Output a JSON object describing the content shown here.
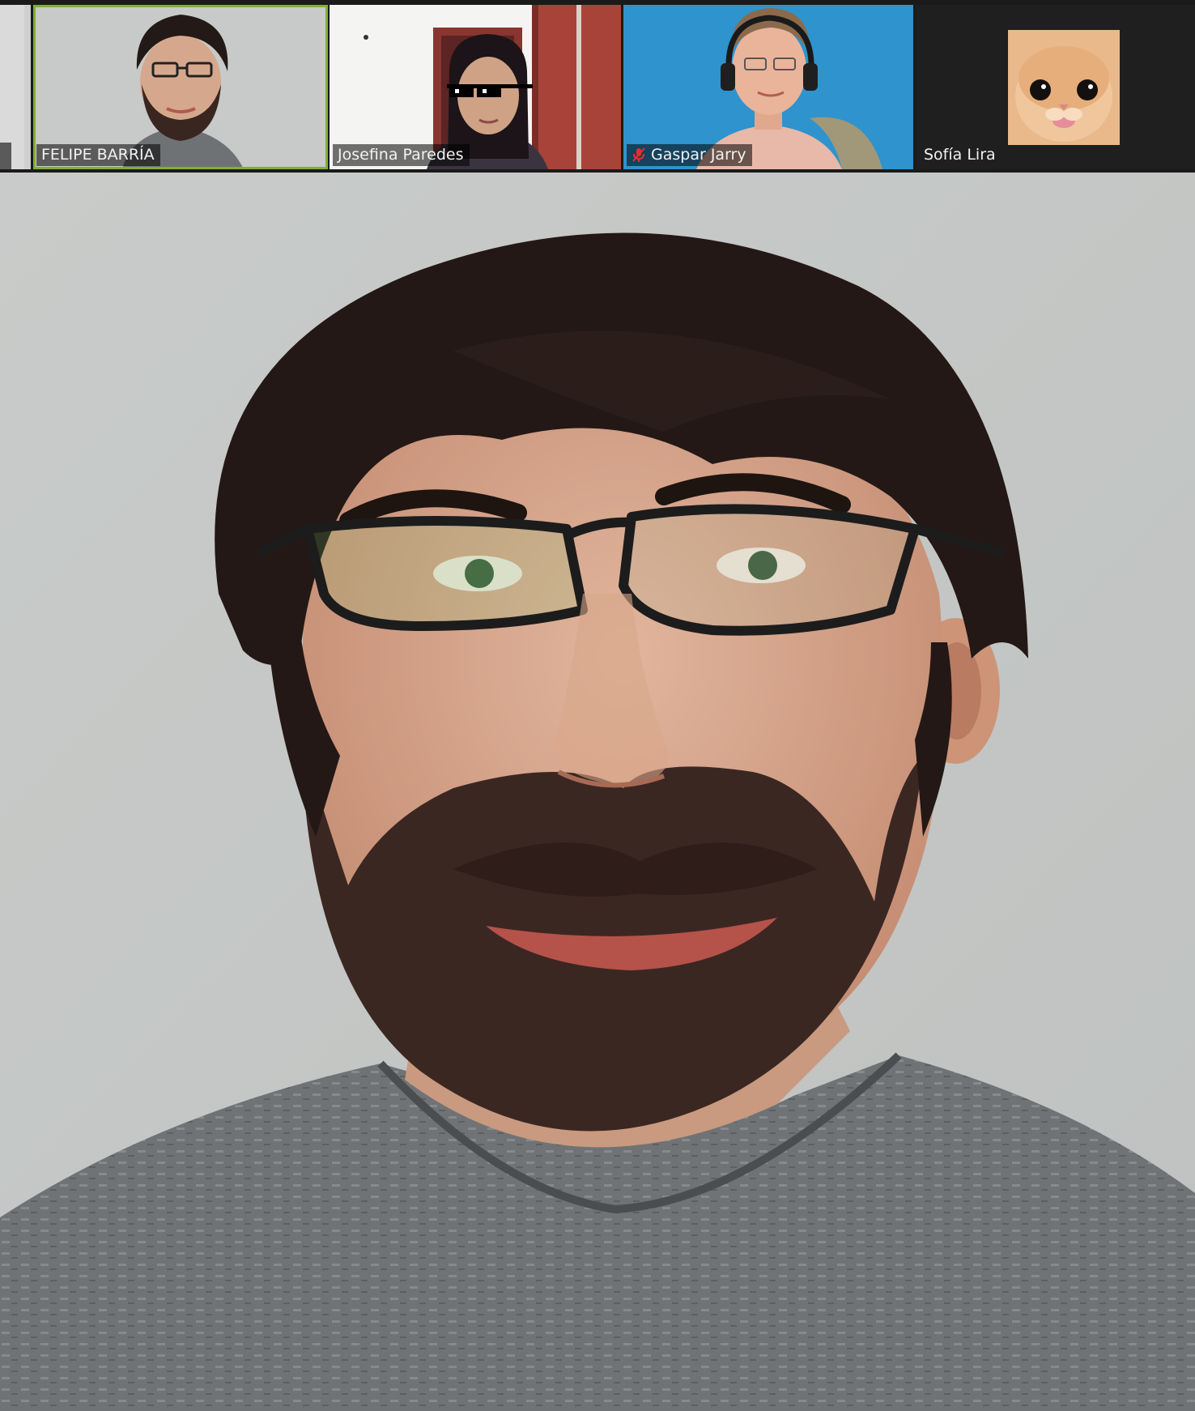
{
  "participants": [
    {
      "id": "partial",
      "name": ""
    },
    {
      "id": "felipe",
      "name": "FELIPE BARRÍA",
      "active_speaker": true
    },
    {
      "id": "josefina",
      "name": "Josefina Paredes"
    },
    {
      "id": "gaspar",
      "name": "Gaspar Jarry",
      "muted": true
    },
    {
      "id": "sofia",
      "name": "Sofía Lira",
      "video_off": true
    }
  ],
  "main_speaker": {
    "name": "FELIPE BARRÍA"
  },
  "colors": {
    "active_border": "#7fae3a",
    "muted_icon": "#e0302a",
    "strip_bg": "#1a1a1a"
  }
}
